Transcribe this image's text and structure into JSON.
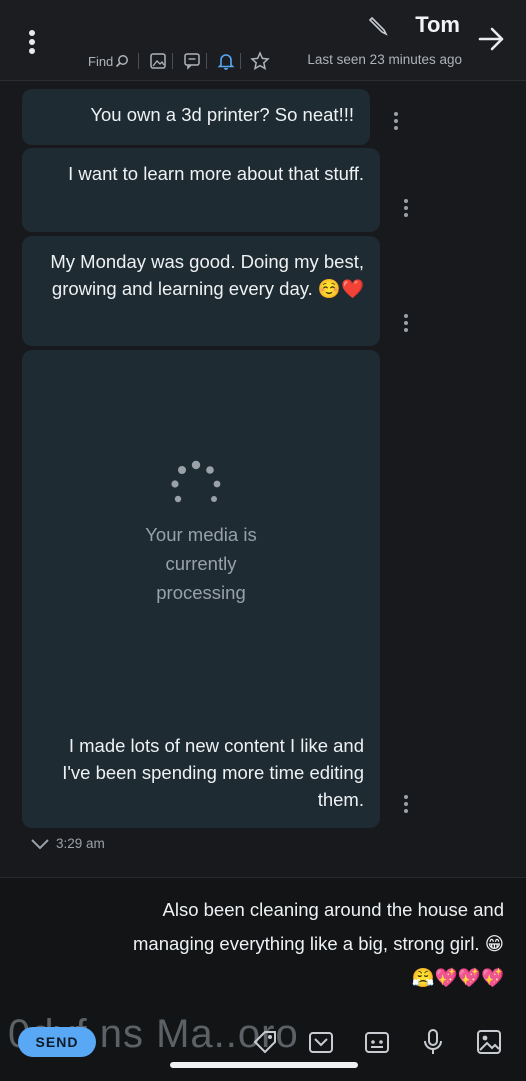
{
  "header": {
    "contact_name": "Tom",
    "last_seen": "Last seen 23 minutes ago",
    "find_label": "Find"
  },
  "messages": [
    {
      "text": "You own a 3d printer? So neat!!!"
    },
    {
      "text": "I want to learn more about that stuff."
    },
    {
      "text": "My Monday was good. Doing my best, growing and learning every day. ☺️❤️"
    },
    {
      "media_status": "Your media is currently processing"
    },
    {
      "text": "I made lots of new content I like and I've been spending more time editing them."
    }
  ],
  "timestamp": "3:29 am",
  "composer": {
    "draft_line1": "Also been cleaning around the house and",
    "draft_line2": "managing everything like a big, strong girl. 😁",
    "draft_line3": "😤💖💖💖",
    "send_label": "SEND",
    "watermark_text": "0dyf ns Ma..oro"
  },
  "colors": {
    "bubble": "#1e2b33",
    "accent": "#58a8f5",
    "background": "#17191c"
  },
  "icons": [
    "back-arrow-icon",
    "pencil-icon",
    "kebab-menu-icon",
    "star-icon",
    "bell-icon",
    "chat-icon",
    "image-icon",
    "search-icon",
    "spinner-icon",
    "chevron-down-icon",
    "gallery-icon",
    "microphone-icon",
    "card-icon",
    "gif-icon",
    "tag-icon"
  ]
}
